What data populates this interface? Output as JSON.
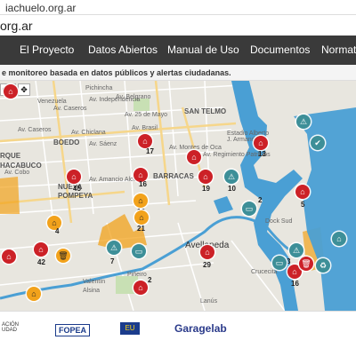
{
  "browser": {
    "url_partial": "iachuelo.org.ar",
    "url_display": "org.ar"
  },
  "nav": {
    "items": [
      {
        "label": "El Proyecto"
      },
      {
        "label": "Datos Abiertos"
      },
      {
        "label": "Manual de Uso"
      },
      {
        "label": "Documentos"
      },
      {
        "label": "Normativ"
      }
    ]
  },
  "subtitle": "e monitoreo basada en datos públicos y alertas ciudadanas.",
  "map": {
    "zoom_label": "dito",
    "move_icon": "✥",
    "labels": [
      {
        "text": "Venezuela"
      },
      {
        "text": "Av. Belgrano"
      },
      {
        "text": "Av. Caseros"
      },
      {
        "text": "Av. 25 de Mayo"
      },
      {
        "text": "SAN TELMO"
      },
      {
        "text": "BOEDO"
      },
      {
        "text": "RQUE"
      },
      {
        "text": "HACABUCO"
      },
      {
        "text": "NUEVA"
      },
      {
        "text": "POMPEYA"
      },
      {
        "text": "BARRACAS"
      },
      {
        "text": "Avellaneda"
      },
      {
        "text": "Dock Sud"
      },
      {
        "text": "Crucecita"
      },
      {
        "text": "Piñeiro"
      },
      {
        "text": "Valentín"
      },
      {
        "text": "Alsina"
      },
      {
        "text": "Lanús"
      },
      {
        "text": "Estadio Alberto J. Armando"
      },
      {
        "text": "Av. Caseros"
      },
      {
        "text": "Av. Chiclana"
      },
      {
        "text": "Av. Cobo"
      },
      {
        "text": "Av. Sáenz"
      },
      {
        "text": "Av. Amancio Alcorta"
      },
      {
        "text": "Av. Regimiento Patricios"
      },
      {
        "text": "Av. Montes de Oca"
      },
      {
        "text": "Av. Brasil"
      },
      {
        "text": "Av. Independencia"
      },
      {
        "text": "Pichincha"
      }
    ],
    "markers": [
      {
        "icon": "factory-icon",
        "color": "red",
        "count": ""
      },
      {
        "icon": "factory-icon",
        "color": "red",
        "count": "17"
      },
      {
        "icon": "factory-icon",
        "color": "red",
        "count": "45"
      },
      {
        "icon": "factory-icon",
        "color": "red",
        "count": "16"
      },
      {
        "icon": "factory-icon",
        "color": "red",
        "count": "19"
      },
      {
        "icon": "factory-icon",
        "color": "red",
        "count": "13"
      },
      {
        "icon": "warning-icon",
        "color": "teal",
        "count": "10"
      },
      {
        "icon": "alert-icon",
        "color": "teal",
        "count": ""
      },
      {
        "icon": "check-icon",
        "color": "teal",
        "count": ""
      },
      {
        "icon": "factory-icon",
        "color": "red",
        "count": "5"
      },
      {
        "icon": "truck-icon",
        "color": "teal",
        "count": "2"
      },
      {
        "icon": "factory-icon",
        "color": "orange",
        "count": "16"
      },
      {
        "icon": "factory-icon",
        "color": "orange",
        "count": "21"
      },
      {
        "icon": "factory-icon",
        "color": "orange",
        "count": "4"
      },
      {
        "icon": "warning-icon",
        "color": "teal",
        "count": "7"
      },
      {
        "icon": "truck-icon",
        "color": "teal",
        "count": ""
      },
      {
        "icon": "factory-icon",
        "color": "red",
        "count": "42"
      },
      {
        "icon": "trash-icon",
        "color": "red",
        "count": ""
      },
      {
        "icon": "factory-icon",
        "color": "red",
        "count": "29"
      },
      {
        "icon": "factory-icon",
        "color": "red",
        "count": "2"
      },
      {
        "icon": "factory-icon",
        "color": "orange",
        "count": ""
      },
      {
        "icon": "warning-icon",
        "color": "teal",
        "count": "3"
      },
      {
        "icon": "factory-icon",
        "color": "red",
        "count": "16"
      },
      {
        "icon": "trash-icon",
        "color": "red",
        "count": ""
      },
      {
        "icon": "truck-icon",
        "color": "teal",
        "count": ""
      },
      {
        "icon": "recycle-icon",
        "color": "teal",
        "count": ""
      },
      {
        "icon": "factory-icon",
        "color": "teal",
        "count": ""
      },
      {
        "icon": "factory-icon",
        "color": "red",
        "count": ""
      },
      {
        "icon": "factory-icon",
        "color": "red",
        "count": ""
      }
    ]
  },
  "footer": {
    "logos": [
      {
        "text": "ACIÓN\nUDAD"
      },
      {
        "text": "FOPEA"
      },
      {
        "text": "EU"
      },
      {
        "text": "Garagelab"
      }
    ]
  },
  "colors": {
    "nav_bg": "#3a3a3a",
    "map_bg": "#e8e6df",
    "river": "#4a9fd4",
    "marker_red": "#cc2127",
    "marker_orange": "#f2a21b",
    "marker_teal": "#3d8f98",
    "zone_orange": "#f2a21b"
  }
}
